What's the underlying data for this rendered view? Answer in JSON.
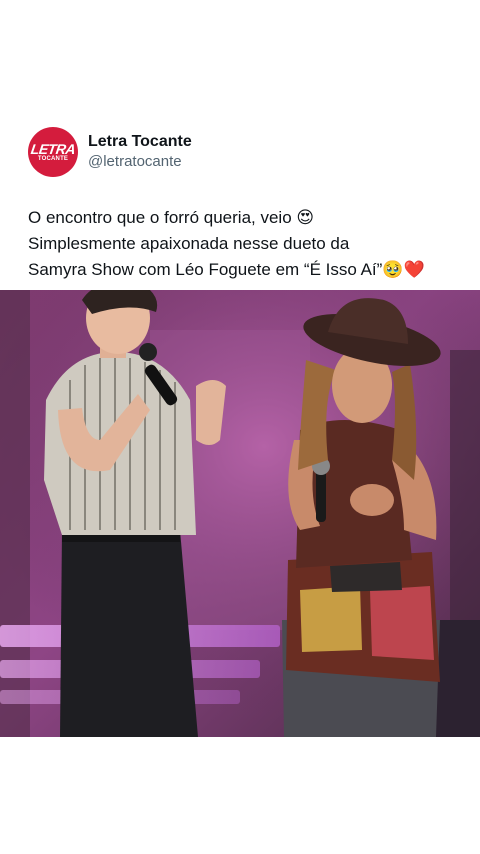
{
  "account": {
    "display_name": "Letra Tocante",
    "handle": "@letratocante",
    "avatar_text_main": "LETRA",
    "avatar_text_sub": "TOCANTE",
    "avatar_color": "#d41c3d"
  },
  "tweet": {
    "lines": [
      "O encontro que o forró queria, veio 😍",
      "Simplesmente apaixonada nesse dueto da",
      "Samyra Show com Léo Foguete em “É Isso Aí”🥹❤️"
    ]
  },
  "media": {
    "type": "photo",
    "stage_color": "#b0489a"
  }
}
